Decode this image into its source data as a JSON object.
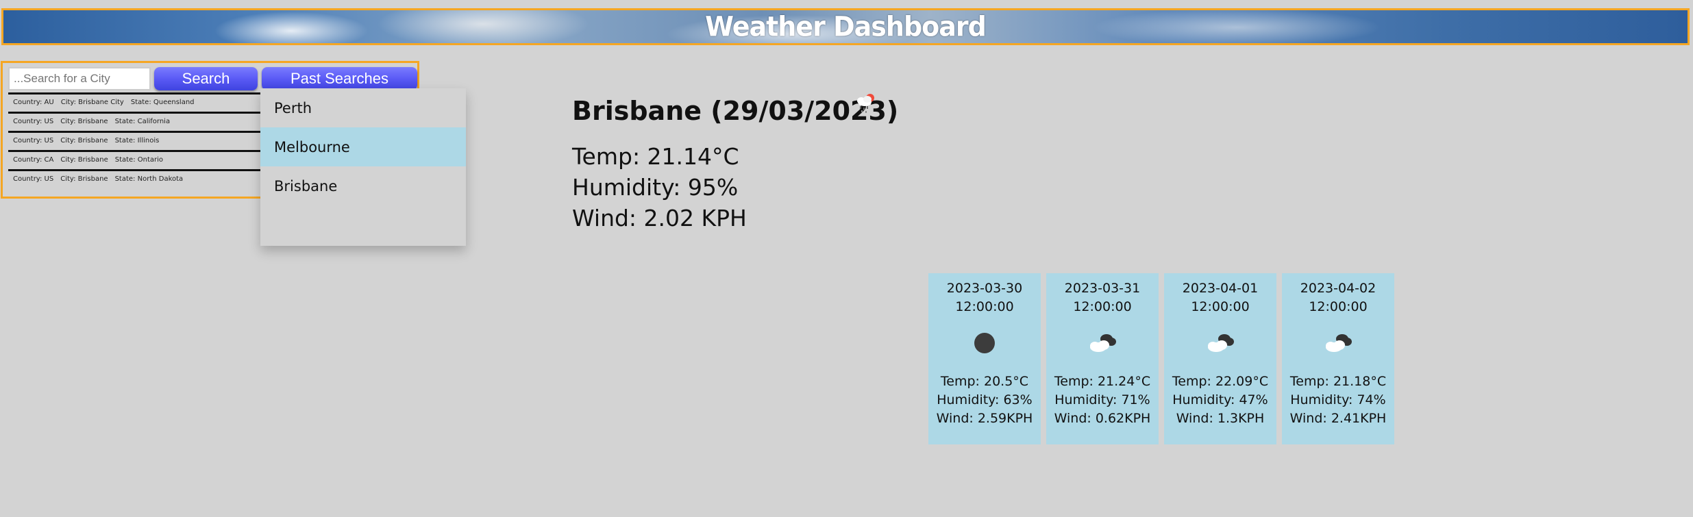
{
  "header": {
    "title": "Weather Dashboard"
  },
  "search": {
    "placeholder": "...Search for a City",
    "search_label": "Search",
    "past_label": "Past Searches"
  },
  "results": [
    {
      "country": "Country: AU",
      "city": "City: Brisbane City",
      "state": "State: Queensland"
    },
    {
      "country": "Country: US",
      "city": "City: Brisbane",
      "state": "State: California"
    },
    {
      "country": "Country: US",
      "city": "City: Brisbane",
      "state": "State: Illinois"
    },
    {
      "country": "Country: CA",
      "city": "City: Brisbane",
      "state": "State: Ontario"
    },
    {
      "country": "Country: US",
      "city": "City: Brisbane",
      "state": "State: North Dakota"
    }
  ],
  "past_searches": [
    "Perth",
    "Melbourne",
    "Brisbane"
  ],
  "current": {
    "title": "Brisbane (29/03/2023)",
    "icon": "snow-rain-icon",
    "temp": "Temp: 21.14°C",
    "humidity": "Humidity: 95%",
    "wind": "Wind: 2.02 KPH"
  },
  "forecast": [
    {
      "date": "2023-03-30",
      "time": "12:00:00",
      "icon": "clear-sky-icon",
      "temp": "Temp: 20.5°C",
      "humidity": "Humidity: 63%",
      "wind": "Wind: 2.59KPH"
    },
    {
      "date": "2023-03-31",
      "time": "12:00:00",
      "icon": "broken-clouds-icon",
      "temp": "Temp: 21.24°C",
      "humidity": "Humidity: 71%",
      "wind": "Wind: 0.62KPH"
    },
    {
      "date": "2023-04-01",
      "time": "12:00:00",
      "icon": "broken-clouds-icon",
      "temp": "Temp: 22.09°C",
      "humidity": "Humidity: 47%",
      "wind": "Wind: 1.3KPH"
    },
    {
      "date": "2023-04-02",
      "time": "12:00:00",
      "icon": "broken-clouds-icon",
      "temp": "Temp: 21.18°C",
      "humidity": "Humidity: 74%",
      "wind": "Wind: 2.41KPH"
    }
  ],
  "colors": {
    "accent_border": "#f5a623",
    "button": "#5a5af5",
    "card_bg": "#add8e6",
    "page_bg": "#d3d3d3"
  }
}
